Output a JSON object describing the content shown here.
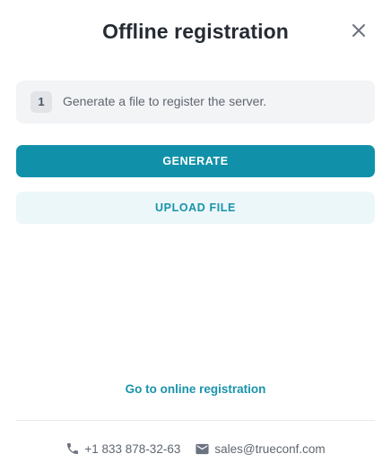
{
  "dialog": {
    "title": "Offline registration"
  },
  "step": {
    "number": "1",
    "text": "Generate a file to register the server."
  },
  "buttons": {
    "generate_label": "GENERATE",
    "upload_label": "UPLOAD FILE"
  },
  "links": {
    "online_registration": "Go to online registration"
  },
  "contacts": {
    "phone": "+1 833 878-32-63",
    "email": "sales@trueconf.com"
  },
  "icons": {
    "close": "close-icon",
    "phone": "phone-icon",
    "email": "email-icon"
  },
  "colors": {
    "accent": "#1191a9",
    "accent_light_bg": "#ecf7fa",
    "link": "#1a93ab",
    "title_text": "#262b33",
    "muted_text": "#5f6670",
    "step_bg": "#f3f4f6"
  }
}
